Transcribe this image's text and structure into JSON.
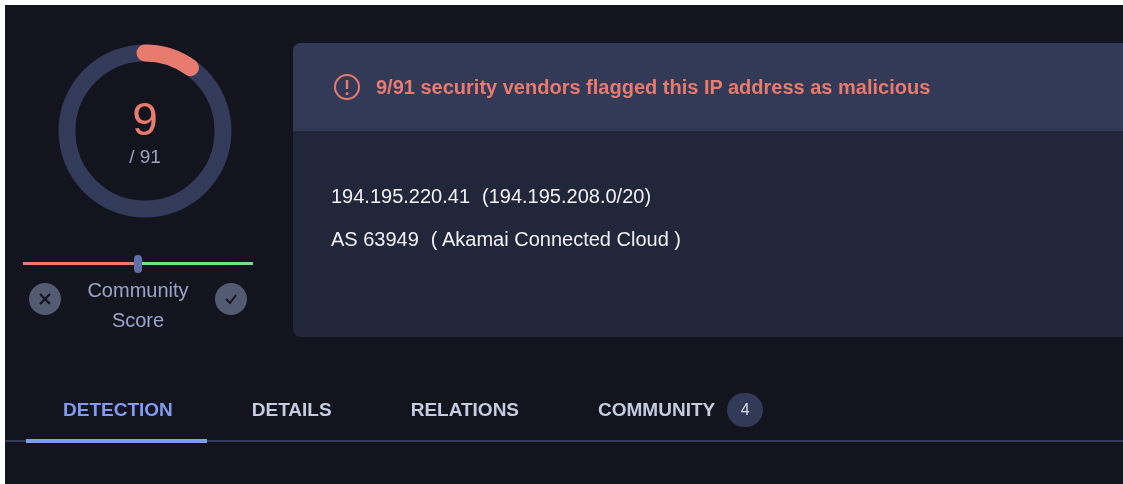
{
  "score": {
    "detections": "9",
    "total": "/ 91"
  },
  "community_score": {
    "label": "Community Score",
    "level": 0.5
  },
  "alert": {
    "text": "9/91 security vendors flagged this IP address as malicious"
  },
  "details": [
    {
      "value": "194.195.220.41",
      "note": "(194.195.208.0/20)"
    },
    {
      "value": "AS 63949",
      "note": "( Akamai Connected Cloud )"
    }
  ],
  "tabs": [
    {
      "label": "DETECTION",
      "selected": true
    },
    {
      "label": "DETAILS",
      "selected": false
    },
    {
      "label": "RELATIONS",
      "selected": false
    },
    {
      "label": "COMMUNITY",
      "selected": false,
      "badge": "4"
    }
  ]
}
